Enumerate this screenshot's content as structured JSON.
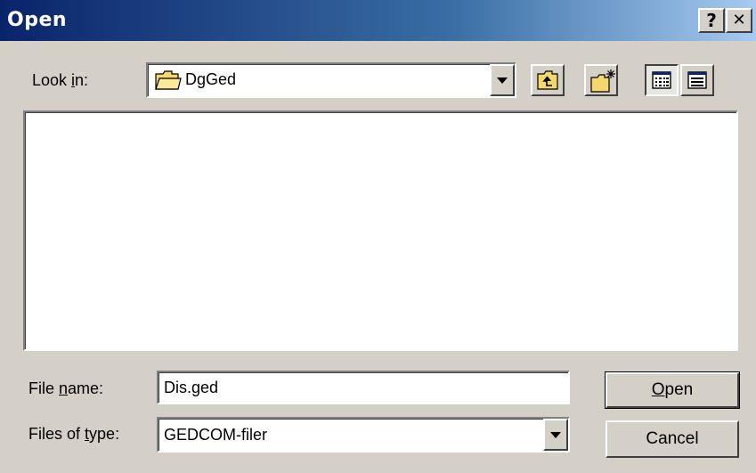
{
  "window": {
    "title": "Open",
    "help_label": "?",
    "close_label": "✕"
  },
  "look_in": {
    "label_pre": "Look ",
    "label_accel": "i",
    "label_post": "n:",
    "value": "DgGed"
  },
  "toolbar": {
    "up_icon": "up-one-level-icon",
    "new_folder_icon": "new-folder-icon",
    "list_view_icon": "list-view-icon",
    "details_view_icon": "details-view-icon"
  },
  "file_name": {
    "label_pre": "File ",
    "label_accel": "n",
    "label_post": "ame:",
    "value": "Dis.ged"
  },
  "file_type": {
    "label_pre": "Files of ",
    "label_accel": "t",
    "label_post": "ype:",
    "value": "GEDCOM-filer"
  },
  "buttons": {
    "open_accel": "O",
    "open_rest": "pen",
    "cancel": "Cancel"
  }
}
